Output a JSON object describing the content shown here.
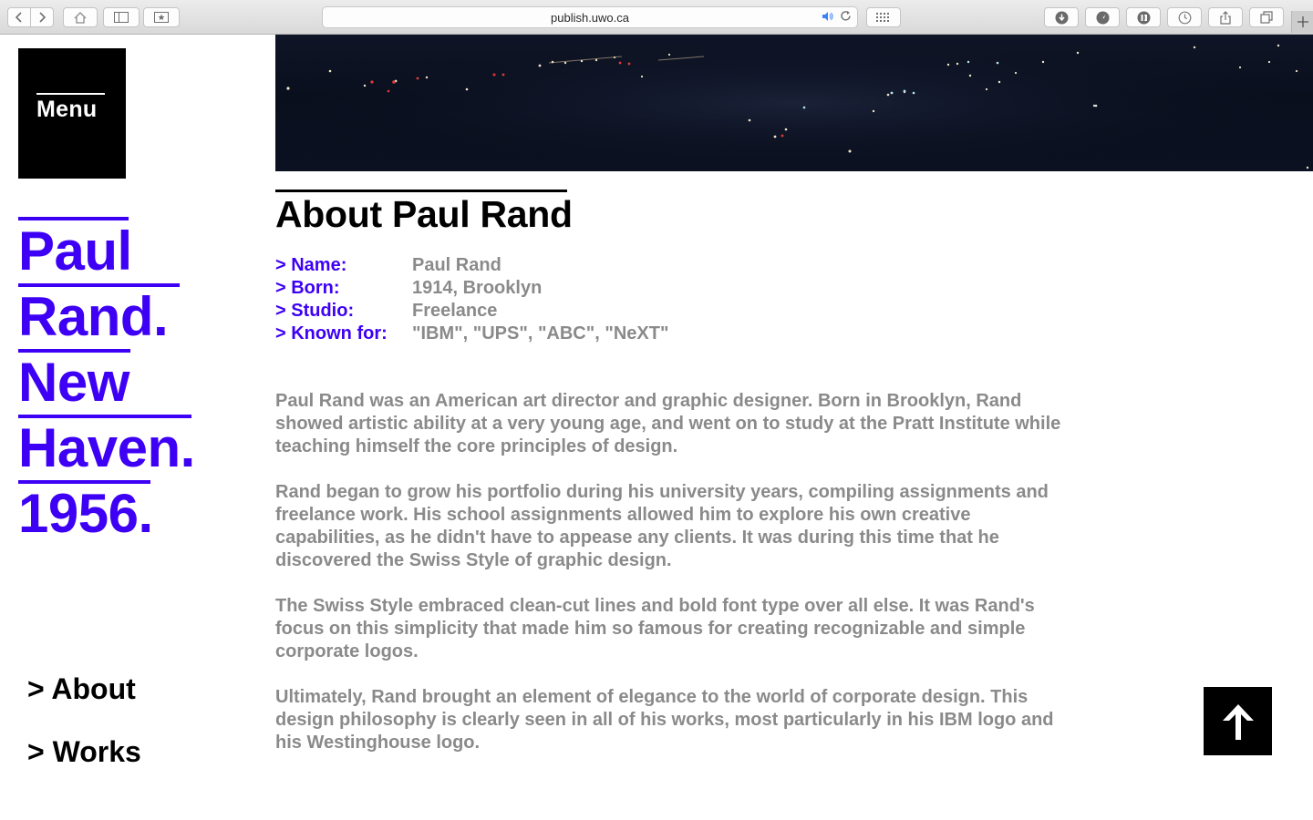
{
  "browser": {
    "url": "publish.uwo.ca",
    "icons": [
      "back-icon",
      "forward-icon",
      "home-icon",
      "sidebar-icon",
      "bookmark-icon",
      "audio-icon",
      "reload-icon",
      "grid-icon",
      "download-icon",
      "history-icon",
      "reader-icon",
      "clock-icon",
      "share-icon",
      "tabs-icon",
      "plus-icon"
    ]
  },
  "sidebar": {
    "menu_label": "Menu",
    "title_words": [
      "Paul",
      "Rand.",
      "New",
      "Haven.",
      "1956."
    ],
    "nav": [
      {
        "label": "> About"
      },
      {
        "label": "> Works"
      }
    ]
  },
  "main": {
    "title": "About Paul Rand",
    "facts": [
      {
        "label": "> Name:",
        "value": "Paul Rand"
      },
      {
        "label": "> Born:",
        "value": "1914, Brooklyn"
      },
      {
        "label": "> Studio:",
        "value": "Freelance"
      },
      {
        "label": "> Known for:",
        "value": "\"IBM\", \"UPS\", \"ABC\", \"NeXT\""
      }
    ],
    "paragraphs": [
      "Paul Rand was an American art director and graphic designer. Born in Brooklyn, Rand showed artistic ability at a very young age, and went on to study at the Pratt Institute while teaching himself the core principles of design.",
      "Rand began to grow his portfolio during his university years, compiling assignments and freelance work. His school assignments allowed him to explore his own creative capabilities, as he didn't have to appease any clients. It was during this time that he discovered the Swiss Style of graphic design.",
      "The Swiss Style embraced clean-cut lines and bold font type over all else. It was Rand's focus on this simplicity that made him so famous for creating recognizable and simple corporate logos.",
      "Ultimately, Rand brought an element of elegance to the world of corporate design. This design philosophy is clearly seen in all of his works, most particularly in his IBM logo and his Westinghouse logo."
    ]
  },
  "colors": {
    "accent": "#3d00f5",
    "body_text": "#8a8a8a",
    "black": "#000000"
  }
}
